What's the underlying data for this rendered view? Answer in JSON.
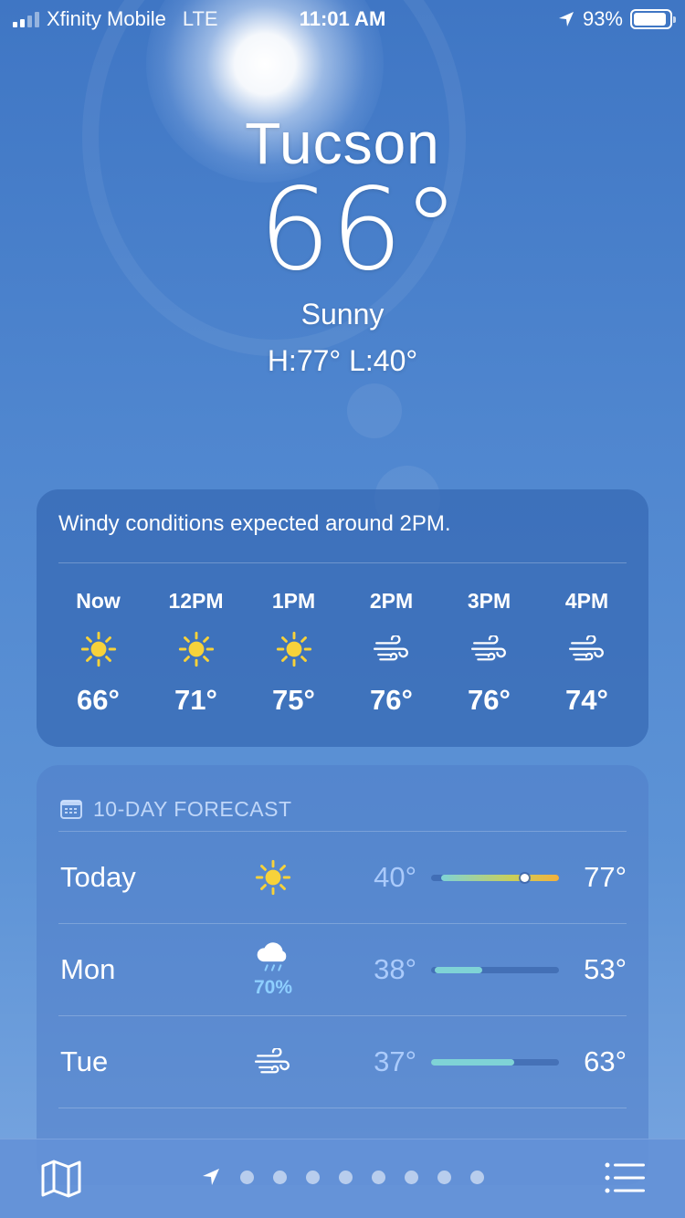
{
  "status_bar": {
    "carrier": "Xfinity Mobile",
    "network": "LTE",
    "time": "11:01 AM",
    "battery": "93%",
    "battery_level": 0.93
  },
  "location": {
    "city": "Tucson",
    "temperature": "66°",
    "condition": "Sunny",
    "high_low": "H:77°  L:40°"
  },
  "hourly": {
    "summary": "Windy conditions expected around 2PM.",
    "hours": [
      {
        "time": "Now",
        "icon": "sun-icon",
        "temp": "66°"
      },
      {
        "time": "12PM",
        "icon": "sun-icon",
        "temp": "71°"
      },
      {
        "time": "1PM",
        "icon": "sun-icon",
        "temp": "75°"
      },
      {
        "time": "2PM",
        "icon": "wind-icon",
        "temp": "76°"
      },
      {
        "time": "3PM",
        "icon": "wind-icon",
        "temp": "76°"
      },
      {
        "time": "4PM",
        "icon": "wind-icon",
        "temp": "74°"
      }
    ]
  },
  "forecast": {
    "header": "10-DAY FORECAST",
    "days": [
      {
        "day": "Today",
        "icon": "sun-icon",
        "precip": "",
        "low": "40°",
        "high": "77°"
      },
      {
        "day": "Mon",
        "icon": "cloud-rain-icon",
        "precip": "70%",
        "low": "38°",
        "high": "53°"
      },
      {
        "day": "Tue",
        "icon": "wind-icon",
        "precip": "",
        "low": "37°",
        "high": "63°"
      }
    ]
  },
  "toolbar": {
    "map_icon": "map-icon",
    "location_icon": "location-arrow-icon",
    "list_icon": "list-icon",
    "page_count": 8
  },
  "colors": {
    "sun": "#f7d23a",
    "bar_cool": "#7fd3d6",
    "bar_warm": "#f4b13c",
    "precip": "#8ecfff"
  }
}
